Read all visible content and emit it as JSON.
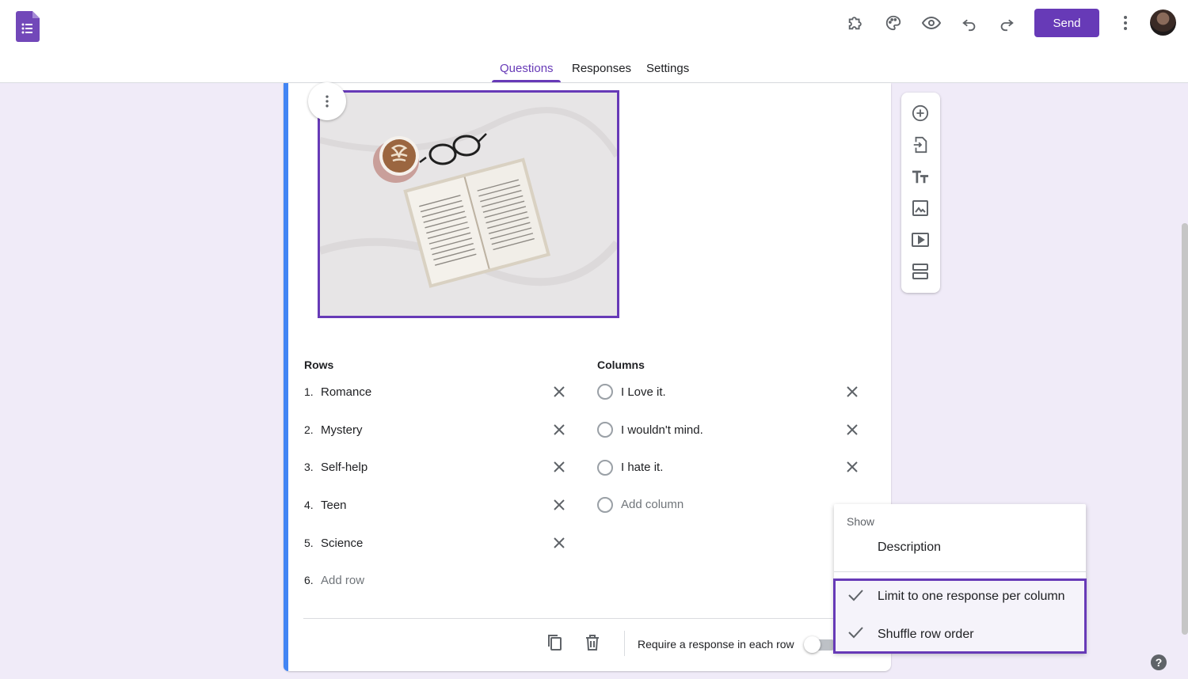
{
  "header": {
    "send_label": "Send",
    "icons": [
      "addons-icon",
      "palette-icon",
      "preview-icon",
      "undo-icon",
      "redo-icon",
      "more-vert-icon"
    ],
    "accent_color": "#673ab7"
  },
  "tabs": [
    {
      "label": "Questions",
      "active": true
    },
    {
      "label": "Responses",
      "active": false
    },
    {
      "label": "Settings",
      "active": false
    }
  ],
  "grid": {
    "rows_heading": "Rows",
    "columns_heading": "Columns",
    "rows": [
      {
        "num": "1.",
        "label": "Romance"
      },
      {
        "num": "2.",
        "label": "Mystery"
      },
      {
        "num": "3.",
        "label": "Self-help"
      },
      {
        "num": "4.",
        "label": "Teen"
      },
      {
        "num": "5.",
        "label": "Science"
      }
    ],
    "add_row": {
      "num": "6.",
      "label": "Add row"
    },
    "columns": [
      "I Love it.",
      "I wouldn't mind.",
      "I hate it."
    ],
    "add_column": "Add column"
  },
  "footer": {
    "require_label": "Require a response in each row",
    "require_enabled": false
  },
  "menu": {
    "section_label": "Show",
    "description": "Description",
    "limit_label": "Limit to one response per column",
    "shuffle_label": "Shuffle row order",
    "limit_checked": true,
    "shuffle_checked": true
  },
  "toolbar_icons": [
    "add-question-icon",
    "import-questions-icon",
    "add-title-icon",
    "add-image-icon",
    "add-video-icon",
    "add-section-icon"
  ],
  "help_label": "?"
}
